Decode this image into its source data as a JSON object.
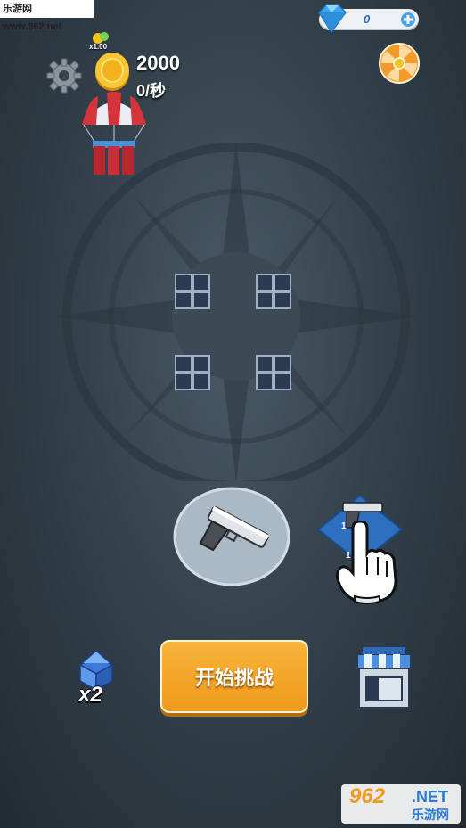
{
  "watermark": {
    "top": "乐游网 www.962.net",
    "bottom_num": "962",
    "bottom_net": ".NET",
    "bottom_cn": "乐游网"
  },
  "currency": {
    "gems": "0",
    "coins": "2000",
    "rate": "0/秒",
    "multiplier": "x1.00"
  },
  "buttons": {
    "start": "开始挑战",
    "chest_multiplier": "x2"
  },
  "merge_slots": {
    "count": 4
  },
  "drag_hint": {
    "level_left": "1",
    "level_right": "1"
  },
  "icons": [
    "settings-gear-icon",
    "gold-coin-icon",
    "diamond-gem-icon",
    "add-plus-icon",
    "lucky-wheel-icon",
    "airdrop-parachute-icon",
    "pistol-icon",
    "treasure-chest-icon",
    "shop-store-icon",
    "tap-hand-icon"
  ],
  "colors": {
    "start_button": "#f0a324",
    "gem_text": "#2a67c9",
    "background": "#34424c"
  }
}
